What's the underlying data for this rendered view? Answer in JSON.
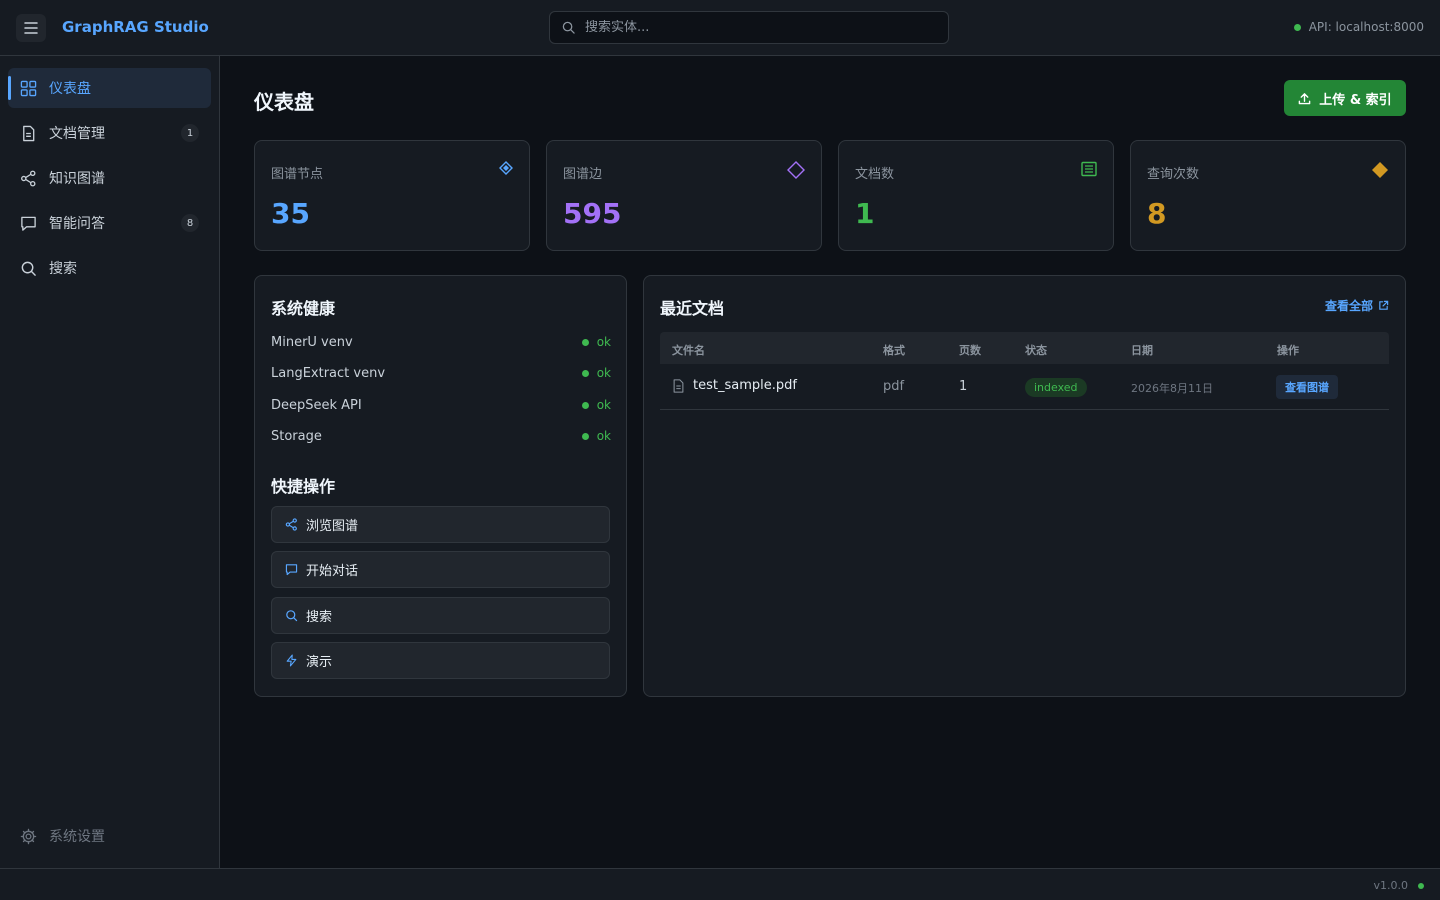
{
  "app": {
    "title": "GraphRAG Studio",
    "api_status": "API: localhost:8000",
    "version": "v1.0.0"
  },
  "search": {
    "placeholder": "搜索实体..."
  },
  "sidebar": {
    "items": [
      {
        "label": "仪表盘",
        "icon": "dashboard-icon",
        "active": true
      },
      {
        "label": "文档管理",
        "icon": "document-icon",
        "badge": "1"
      },
      {
        "label": "知识图谱",
        "icon": "share-graph-icon"
      },
      {
        "label": "智能问答",
        "icon": "chat-icon",
        "badge": "8"
      },
      {
        "label": "搜索",
        "icon": "search-icon"
      }
    ],
    "settings_label": "系统设置"
  },
  "main": {
    "title": "仪表盘",
    "upload_label": "上传 & 索引",
    "stats": [
      {
        "label": "图谱节点",
        "value": "35",
        "color": "#58a6ff",
        "icon": "node-diamond-icon"
      },
      {
        "label": "图谱边",
        "value": "595",
        "color": "#a371f7",
        "icon": "edge-diamond-icon"
      },
      {
        "label": "文档数",
        "value": "1",
        "color": "#3fb950",
        "icon": "document-list-icon"
      },
      {
        "label": "查询次数",
        "value": "8",
        "color": "#d29922",
        "icon": "query-diamond-icon"
      }
    ]
  },
  "health": {
    "title": "系统健康",
    "items": [
      {
        "name": "MinerU venv",
        "status": "ok"
      },
      {
        "name": "LangExtract venv",
        "status": "ok"
      },
      {
        "name": "DeepSeek API",
        "status": "ok"
      },
      {
        "name": "Storage",
        "status": "ok"
      }
    ]
  },
  "quick": {
    "title": "快捷操作",
    "items": [
      {
        "label": "浏览图谱",
        "icon": "share-graph-icon"
      },
      {
        "label": "开始对话",
        "icon": "chat-icon"
      },
      {
        "label": "搜索",
        "icon": "search-icon"
      },
      {
        "label": "演示",
        "icon": "lightning-icon"
      }
    ]
  },
  "recent": {
    "title": "最近文档",
    "view_all": "查看全部",
    "columns": [
      "文件名",
      "格式",
      "页数",
      "状态",
      "日期",
      "操作"
    ],
    "rows": [
      {
        "filename": "test_sample.pdf",
        "format": "pdf",
        "pages": "1",
        "status": "indexed",
        "date": "2026年8月11日",
        "action": "查看图谱"
      }
    ]
  }
}
